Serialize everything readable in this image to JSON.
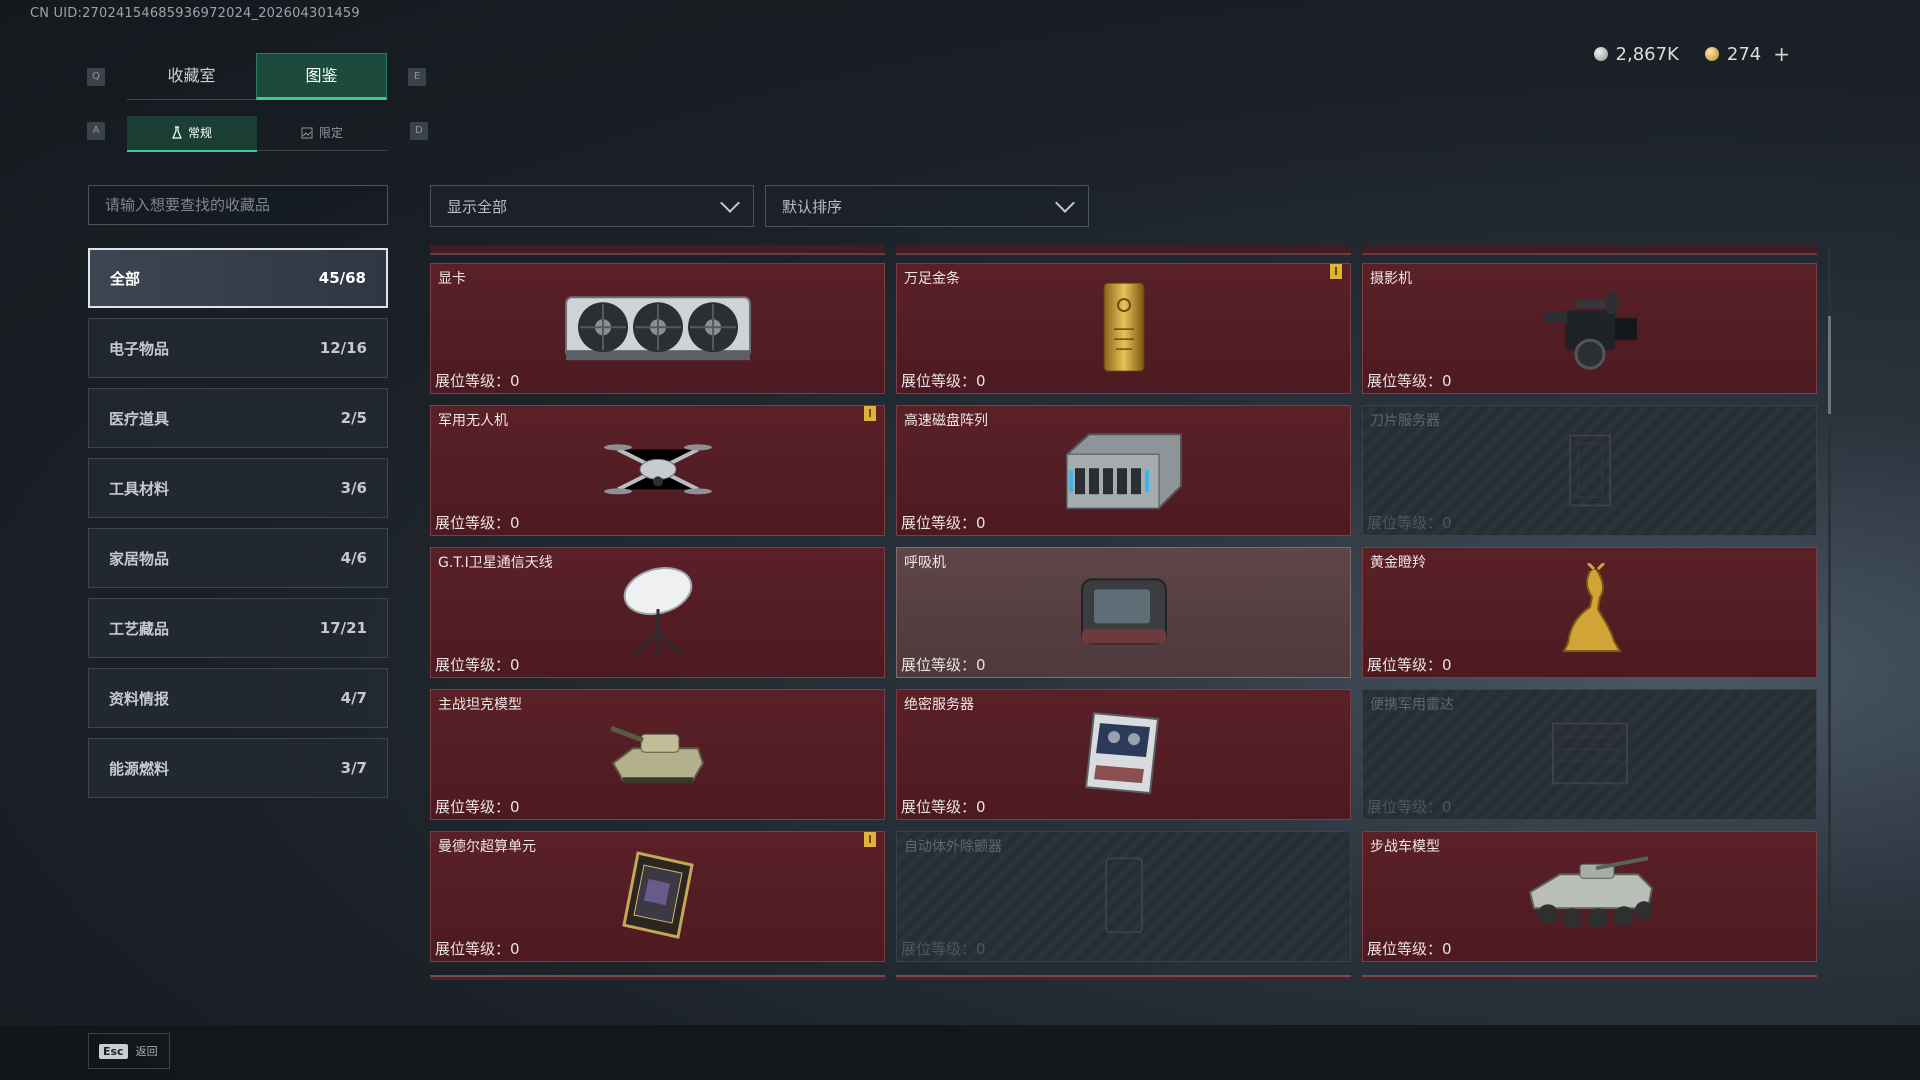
{
  "uid": "CN UID:27024154685936972024_202604301459",
  "currency": {
    "silver": "2,867K",
    "gold": "274",
    "plus": "+"
  },
  "keys": {
    "q": "Q",
    "e": "E",
    "a": "A",
    "d": "D",
    "esc": "Esc"
  },
  "tabs": [
    "收藏室",
    "图鉴"
  ],
  "subtabs": [
    "常规",
    "限定"
  ],
  "search": {
    "placeholder": "请输入想要查找的收藏品"
  },
  "filters": {
    "show": "显示全部",
    "sort": "默认排序"
  },
  "categories": [
    {
      "label": "全部",
      "count": "45/68"
    },
    {
      "label": "电子物品",
      "count": "12/16"
    },
    {
      "label": "医疗道具",
      "count": "2/5"
    },
    {
      "label": "工具材料",
      "count": "3/6"
    },
    {
      "label": "家居物品",
      "count": "4/6"
    },
    {
      "label": "工艺藏品",
      "count": "17/21"
    },
    {
      "label": "资料情报",
      "count": "4/7"
    },
    {
      "label": "能源燃料",
      "count": "3/7"
    }
  ],
  "items": [
    {
      "name": "显卡",
      "level": "展位等级：0",
      "icon": "graphics-card-icon"
    },
    {
      "name": "万足金条",
      "level": "展位等级：0",
      "icon": "gold-bar-icon"
    },
    {
      "name": "摄影机",
      "level": "展位等级：0",
      "icon": "camera-icon"
    },
    {
      "name": "军用无人机",
      "level": "展位等级：0",
      "icon": "drone-icon"
    },
    {
      "name": "高速磁盘阵列",
      "level": "展位等级：0",
      "icon": "disk-array-icon"
    },
    {
      "name": "刀片服务器",
      "level": "展位等级：0",
      "icon": "blade-server-icon"
    },
    {
      "name": "G.T.I卫星通信天线",
      "level": "展位等级：0",
      "icon": "satellite-antenna-icon"
    },
    {
      "name": "呼吸机",
      "level": "展位等级：0",
      "icon": "ventilator-icon"
    },
    {
      "name": "黄金瞪羚",
      "level": "展位等级：0",
      "icon": "golden-gazelle-icon"
    },
    {
      "name": "主战坦克模型",
      "level": "展位等级：0",
      "icon": "tank-model-icon"
    },
    {
      "name": "绝密服务器",
      "level": "展位等级：0",
      "icon": "secret-server-icon"
    },
    {
      "name": "便携军用雷达",
      "level": "展位等级：0",
      "icon": "portable-radar-icon"
    },
    {
      "name": "曼德尔超算单元",
      "level": "展位等级：0",
      "icon": "supercomputer-unit-icon"
    },
    {
      "name": "自动体外除颤器",
      "level": "展位等级：0",
      "icon": "defibrillator-icon"
    },
    {
      "name": "步战车模型",
      "level": "展位等级：0",
      "icon": "ifv-model-icon"
    }
  ],
  "back_label": "返回",
  "colors": {
    "accent": "#3ecb8f",
    "card_red": "#5a2027",
    "badge": "#e0b23a"
  }
}
